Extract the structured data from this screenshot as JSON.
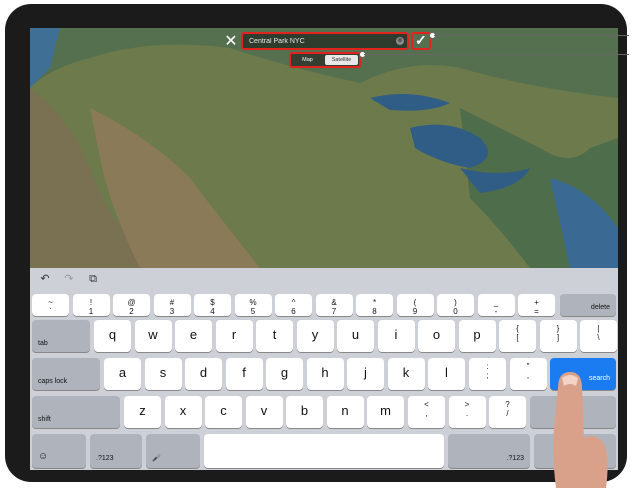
{
  "toolbar": {
    "search_value": "Central Park NYC",
    "search_clear": "⊗",
    "close": "✕",
    "done": "✓"
  },
  "map_type": {
    "options": [
      "Map",
      "Satellite"
    ],
    "selected": "Satellite"
  },
  "keyboard": {
    "shortcuts": [
      "↶",
      "↷",
      "⧉"
    ],
    "row1": [
      {
        "top": "~",
        "bottom": "`"
      },
      {
        "top": "!",
        "bottom": "1"
      },
      {
        "top": "@",
        "bottom": "2"
      },
      {
        "top": "#",
        "bottom": "3"
      },
      {
        "top": "$",
        "bottom": "4"
      },
      {
        "top": "%",
        "bottom": "5"
      },
      {
        "top": "^",
        "bottom": "6"
      },
      {
        "top": "&",
        "bottom": "7"
      },
      {
        "top": "*",
        "bottom": "8"
      },
      {
        "top": "(",
        "bottom": "9"
      },
      {
        "top": ")",
        "bottom": "0"
      },
      {
        "top": "_",
        "bottom": "-"
      },
      {
        "top": "+",
        "bottom": "="
      }
    ],
    "delete": "delete",
    "tab": "tab",
    "row2": [
      "q",
      "w",
      "e",
      "r",
      "t",
      "y",
      "u",
      "i",
      "o",
      "p"
    ],
    "row2_sym": [
      {
        "top": "{",
        "bottom": "["
      },
      {
        "top": "}",
        "bottom": "]"
      },
      {
        "top": "|",
        "bottom": "\\"
      }
    ],
    "caps": "caps lock",
    "row3": [
      "a",
      "s",
      "d",
      "f",
      "g",
      "h",
      "j",
      "k",
      "l"
    ],
    "row3_sym": [
      {
        "top": ":",
        "bottom": ";"
      },
      {
        "top": "\"",
        "bottom": ","
      }
    ],
    "search": "search",
    "shift": "shift",
    "row4": [
      "z",
      "x",
      "c",
      "v",
      "b",
      "n",
      "m"
    ],
    "row4_sym": [
      {
        "top": "<",
        "bottom": ","
      },
      {
        "top": ">",
        "bottom": "."
      },
      {
        "top": "?",
        "bottom": "/"
      }
    ],
    "emoji": "☺",
    "num_left": ".?123",
    "mic": "🎤",
    "num_right": ".?123"
  }
}
